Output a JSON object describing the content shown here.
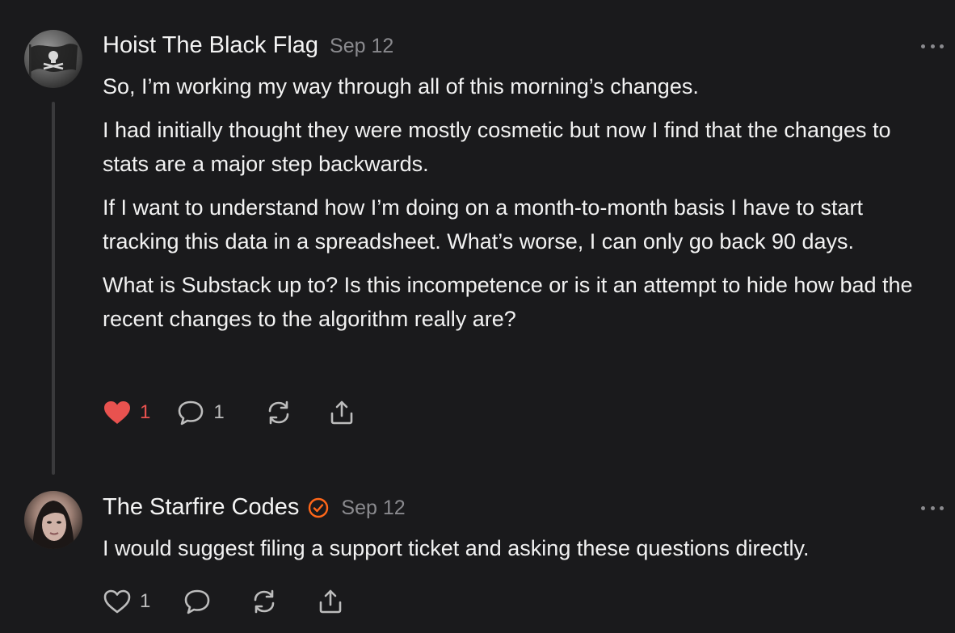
{
  "comments": [
    {
      "author": "Hoist The Black Flag",
      "date": "Sep 12",
      "verified": false,
      "avatar_icon": "pirate-flag-avatar",
      "paragraphs": [
        "So, I’m working my way through all of this morning’s changes.",
        "I had initially thought they were mostly cosmetic but now I find that the changes to stats are a major step backwards.",
        "If I want to understand how I’m doing on a month-to-month basis I have to start tracking this data in a spreadsheet. What’s worse, I can only go back 90 days.",
        "What is Substack up to? Is this incompetence or is it an attempt to hide how bad the recent changes to the algorithm really are?"
      ],
      "likes": "1",
      "liked": true,
      "replies": "1"
    },
    {
      "author": "The Starfire Codes",
      "date": "Sep 12",
      "verified": true,
      "avatar_icon": "profile-photo-avatar",
      "paragraphs": [
        "I would suggest filing a support ticket and asking these questions directly."
      ],
      "likes": "1",
      "liked": false,
      "replies": ""
    }
  ],
  "colors": {
    "background": "#1a1a1c",
    "like_active": "#e8524f",
    "verified_badge": "#ff6719",
    "muted": "#8a8a8e"
  }
}
